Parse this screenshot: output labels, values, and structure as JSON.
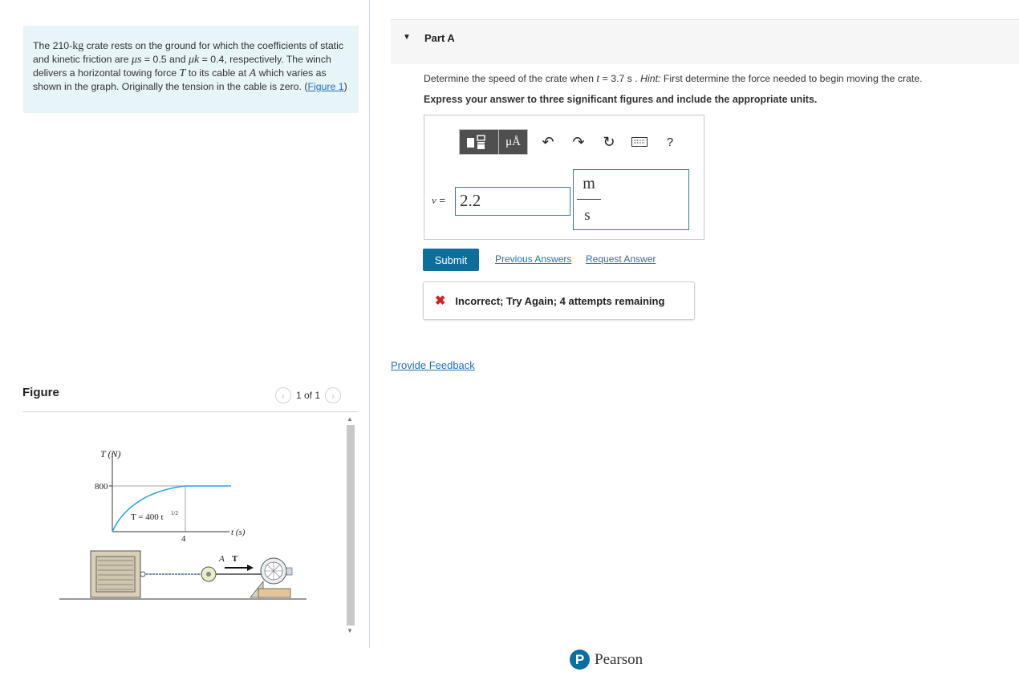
{
  "problem": {
    "text_1": "The 210-",
    "unit_kg": "kg",
    "text_2": " crate rests on the ground for which the coefficients of static and kinetic friction are ",
    "mu_s": "μs",
    "text_3": " = 0.5 and ",
    "mu_k": "μk",
    "text_4": " = 0.4, respectively. The winch delivers a horizontal towing force ",
    "var_T": "T",
    "text_5": " to its cable at ",
    "var_A": "A",
    "text_6": " which varies as shown in the graph. Originally the tension in the cable is zero. (",
    "figure_link": "Figure 1",
    "text_7": ")"
  },
  "figure": {
    "title": "Figure",
    "pager_text": "1 of 1",
    "graph": {
      "y_axis_label": "T (N)",
      "y_tick": "800",
      "x_tick": "4",
      "x_axis_label": "t (s)",
      "curve_label": "T = 400 t",
      "curve_exponent": "1/2",
      "label_A": "A",
      "label_T": "T"
    }
  },
  "part_a": {
    "label": "Part A",
    "question_pre": "Determine the speed of the crate when ",
    "question_var": "t",
    "question_mid": " = 3.7  s . ",
    "hint_label": "Hint:",
    "hint_text": " First determine the force needed to begin moving the crate.",
    "express": "Express your answer to three significant figures and include the appropriate units.",
    "toolbar": {
      "mu_a_label": "μÅ",
      "help_label": "?"
    },
    "var_label": "v",
    "eq_label": " =",
    "answer_value": "2.2",
    "units_num": "m",
    "units_den": "s",
    "submit_label": "Submit",
    "previous_answers_label": "Previous Answers",
    "request_answer_label": "Request Answer",
    "result_message": "Incorrect; Try Again; 4 attempts remaining",
    "feedback_label": "Provide Feedback"
  },
  "footer": {
    "brand": "Pearson",
    "logo_letter": "P"
  },
  "colors": {
    "problem_bg": "#e7f4f8",
    "link": "#1f6fb5",
    "submit_bg": "#0d6e9c",
    "error": "#d41f1f",
    "curve": "#29a3e0"
  }
}
